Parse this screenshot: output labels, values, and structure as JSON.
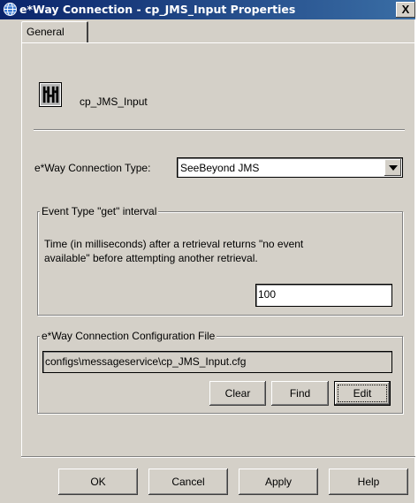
{
  "window": {
    "title": "e*Way Connection - cp_JMS_Input Properties",
    "close_label": "X"
  },
  "tabs": [
    {
      "label": "General",
      "selected": true
    }
  ],
  "connection": {
    "name": "cp_JMS_Input",
    "icon": "connection-icon"
  },
  "connection_type": {
    "label": "e*Way Connection Type:",
    "value": "SeeBeyond JMS"
  },
  "event_interval": {
    "legend": "Event Type \"get\" interval",
    "description": "Time (in milliseconds) after a retrieval returns \"no event available\" before attempting another retrieval.",
    "value": "100"
  },
  "config_file": {
    "legend": "e*Way Connection Configuration File",
    "path": "configs\\messageservice\\cp_JMS_Input.cfg",
    "buttons": {
      "clear": "Clear",
      "find": "Find",
      "edit": "Edit"
    }
  },
  "footer": {
    "ok": "OK",
    "cancel": "Cancel",
    "apply": "Apply",
    "help": "Help"
  },
  "colors": {
    "titlebar_start": "#0a246a",
    "titlebar_end": "#3a6ea5",
    "face": "#d4d0c8"
  }
}
